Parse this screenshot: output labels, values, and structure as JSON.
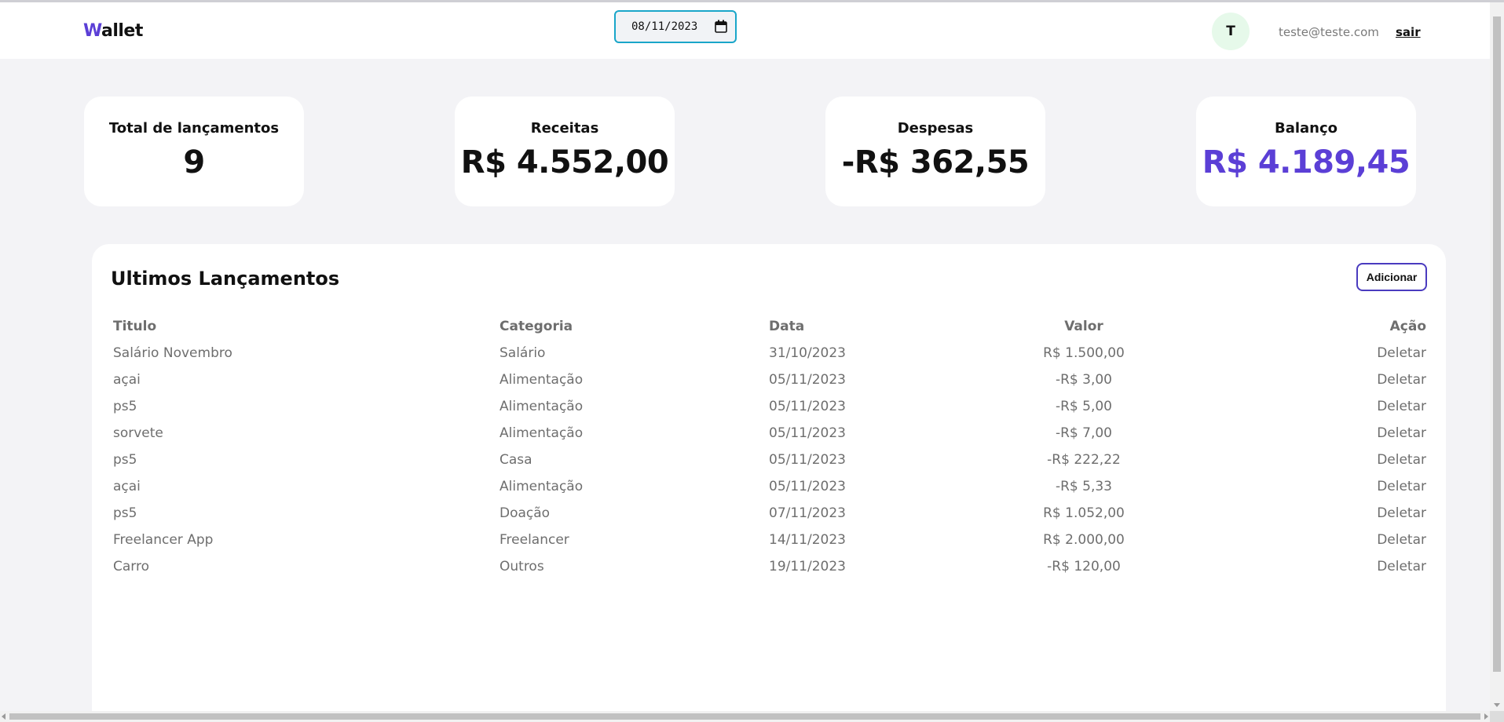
{
  "header": {
    "logo_first": "W",
    "logo_rest": "allet",
    "date_value": "08/11/2023",
    "avatar_initial": "T",
    "email": "teste@teste.com",
    "logout_label": "sair"
  },
  "summary": {
    "total": {
      "label": "Total de lançamentos",
      "value": "9"
    },
    "income": {
      "label": "Receitas",
      "value": "R$ 4.552,00"
    },
    "expenses": {
      "label": "Despesas",
      "value": "-R$ 362,55"
    },
    "balance": {
      "label": "Balanço",
      "value": "R$ 4.189,45"
    }
  },
  "transactions": {
    "title": "Ultimos Lançamentos",
    "add_label": "Adicionar",
    "columns": [
      "Titulo",
      "Categoria",
      "Data",
      "Valor",
      "Ação"
    ],
    "rows": [
      {
        "title": "Salário Novembro",
        "category": "Salário",
        "date": "31/10/2023",
        "value": "R$ 1.500,00",
        "action": "Deletar"
      },
      {
        "title": "açai",
        "category": "Alimentação",
        "date": "05/11/2023",
        "value": "-R$ 3,00",
        "action": "Deletar"
      },
      {
        "title": "ps5",
        "category": "Alimentação",
        "date": "05/11/2023",
        "value": "-R$ 5,00",
        "action": "Deletar"
      },
      {
        "title": "sorvete",
        "category": "Alimentação",
        "date": "05/11/2023",
        "value": "-R$ 7,00",
        "action": "Deletar"
      },
      {
        "title": "ps5",
        "category": "Casa",
        "date": "05/11/2023",
        "value": "-R$ 222,22",
        "action": "Deletar"
      },
      {
        "title": "açai",
        "category": "Alimentação",
        "date": "05/11/2023",
        "value": "-R$ 5,33",
        "action": "Deletar"
      },
      {
        "title": "ps5",
        "category": "Doação",
        "date": "07/11/2023",
        "value": "R$ 1.052,00",
        "action": "Deletar"
      },
      {
        "title": "Freelancer App",
        "category": "Freelancer",
        "date": "14/11/2023",
        "value": "R$ 2.000,00",
        "action": "Deletar"
      },
      {
        "title": "Carro",
        "category": "Outros",
        "date": "19/11/2023",
        "value": "-R$ 120,00",
        "action": "Deletar"
      }
    ]
  },
  "colors": {
    "accent": "#5b3fd6",
    "date_border": "#1aa6c9",
    "avatar_bg": "#e6f9ea",
    "background": "#f3f3f6"
  },
  "icons": {
    "date_picker": "calendar-icon"
  }
}
